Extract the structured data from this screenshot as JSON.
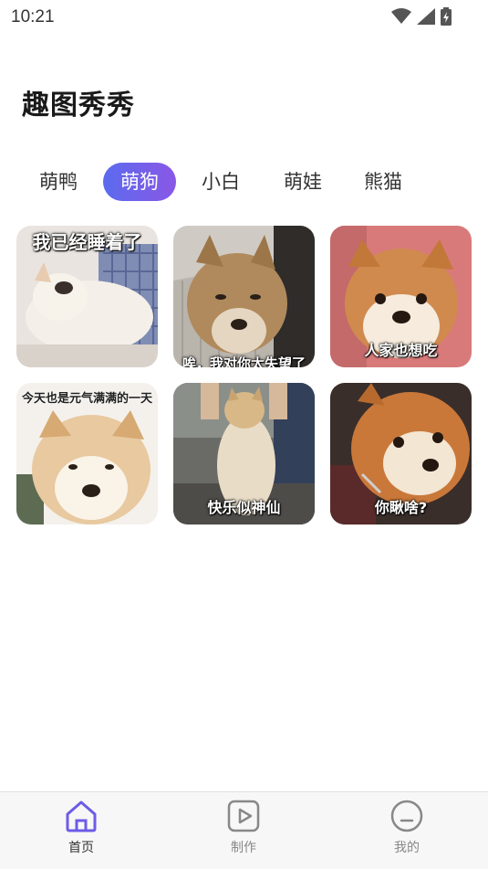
{
  "status_bar": {
    "time": "10:21",
    "icons": [
      "wifi-icon",
      "signal-icon",
      "battery-icon"
    ]
  },
  "page": {
    "title": "趣图秀秀"
  },
  "tabs": [
    {
      "label": "萌鸭",
      "active": false
    },
    {
      "label": "萌狗",
      "active": true
    },
    {
      "label": "小白",
      "active": false
    },
    {
      "label": "萌娃",
      "active": false
    },
    {
      "label": "熊猫",
      "active": false
    }
  ],
  "gallery": [
    {
      "caption": "我已经睡着了"
    },
    {
      "caption": "唉，我对你太失望了"
    },
    {
      "caption": "人家也想吃"
    },
    {
      "caption": "今天也是元气满满的一天"
    },
    {
      "caption": "快乐似神仙"
    },
    {
      "caption": "你瞅啥?"
    }
  ],
  "bottom_nav": [
    {
      "label": "首页",
      "icon": "home-icon",
      "active": true
    },
    {
      "label": "制作",
      "icon": "play-icon",
      "active": false
    },
    {
      "label": "我的",
      "icon": "profile-icon",
      "active": false
    }
  ],
  "colors": {
    "accent_start": "#5b6bee",
    "accent_end": "#8a57e6",
    "active_icon": "#6c5ce7"
  }
}
